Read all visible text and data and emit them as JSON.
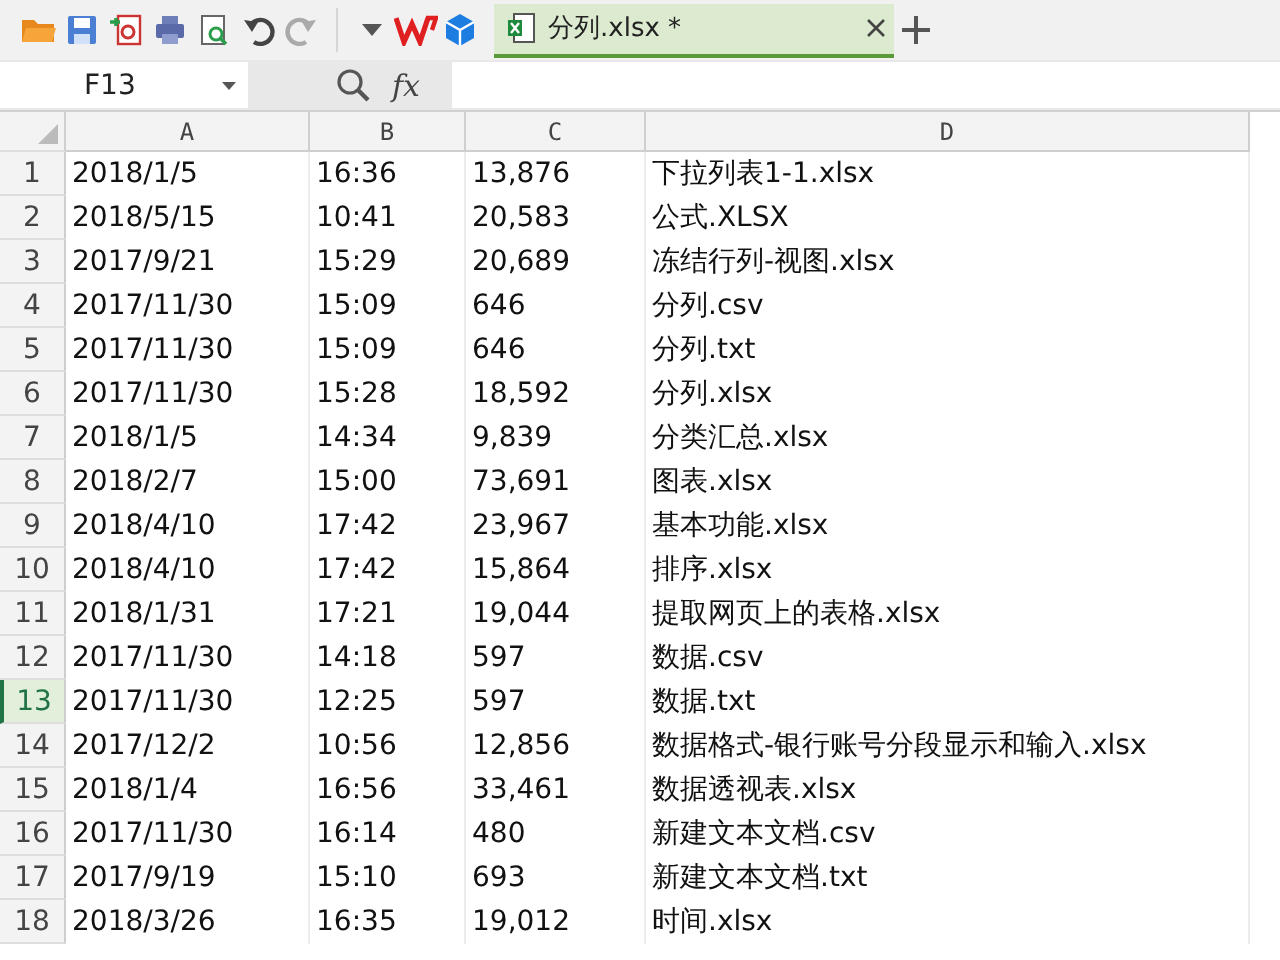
{
  "toolbar": {
    "tab": {
      "label": "分列.xlsx *",
      "selected": true
    }
  },
  "formula_bar": {
    "name_box": "F13",
    "fx": "fx"
  },
  "sheet": {
    "columns": [
      "A",
      "B",
      "C",
      "D"
    ],
    "rows": [
      {
        "number": "1",
        "selected": false,
        "cells": [
          "2018/1/5",
          "16:36",
          "13,876",
          "下拉列表1-1.xlsx"
        ]
      },
      {
        "number": "2",
        "selected": false,
        "cells": [
          "2018/5/15",
          "10:41",
          "20,583",
          "公式.XLSX"
        ]
      },
      {
        "number": "3",
        "selected": false,
        "cells": [
          "2017/9/21",
          "15:29",
          "20,689",
          "冻结行列-视图.xlsx"
        ]
      },
      {
        "number": "4",
        "selected": false,
        "cells": [
          "2017/11/30",
          "15:09",
          "646",
          "分列.csv"
        ]
      },
      {
        "number": "5",
        "selected": false,
        "cells": [
          "2017/11/30",
          "15:09",
          "646",
          "分列.txt"
        ]
      },
      {
        "number": "6",
        "selected": false,
        "cells": [
          "2017/11/30",
          "15:28",
          "18,592",
          "分列.xlsx"
        ]
      },
      {
        "number": "7",
        "selected": false,
        "cells": [
          "2018/1/5",
          "14:34",
          "9,839",
          "分类汇总.xlsx"
        ]
      },
      {
        "number": "8",
        "selected": false,
        "cells": [
          "2018/2/7",
          "15:00",
          "73,691",
          "图表.xlsx"
        ]
      },
      {
        "number": "9",
        "selected": false,
        "cells": [
          "2018/4/10",
          "17:42",
          "23,967",
          "基本功能.xlsx"
        ]
      },
      {
        "number": "10",
        "selected": false,
        "cells": [
          "2018/4/10",
          "17:42",
          "15,864",
          "排序.xlsx"
        ]
      },
      {
        "number": "11",
        "selected": false,
        "cells": [
          "2018/1/31",
          "17:21",
          "19,044",
          "提取网页上的表格.xlsx"
        ]
      },
      {
        "number": "12",
        "selected": false,
        "cells": [
          "2017/11/30",
          "14:18",
          "597",
          "数据.csv"
        ]
      },
      {
        "number": "13",
        "selected": true,
        "cells": [
          "2017/11/30",
          "12:25",
          "597",
          "数据.txt"
        ]
      },
      {
        "number": "14",
        "selected": false,
        "cells": [
          "2017/12/2",
          "10:56",
          "12,856",
          "数据格式-银行账号分段显示和输入.xlsx"
        ]
      },
      {
        "number": "15",
        "selected": false,
        "cells": [
          "2018/1/4",
          "16:56",
          "33,461",
          "数据透视表.xlsx"
        ]
      },
      {
        "number": "16",
        "selected": false,
        "cells": [
          "2017/11/30",
          "16:14",
          "480",
          "新建文本文档.csv"
        ]
      },
      {
        "number": "17",
        "selected": false,
        "cells": [
          "2017/9/19",
          "15:10",
          "693",
          "新建文本文档.txt"
        ]
      },
      {
        "number": "18",
        "selected": false,
        "cells": [
          "2018/3/26",
          "16:35",
          "19,012",
          "时间.xlsx"
        ]
      }
    ]
  }
}
